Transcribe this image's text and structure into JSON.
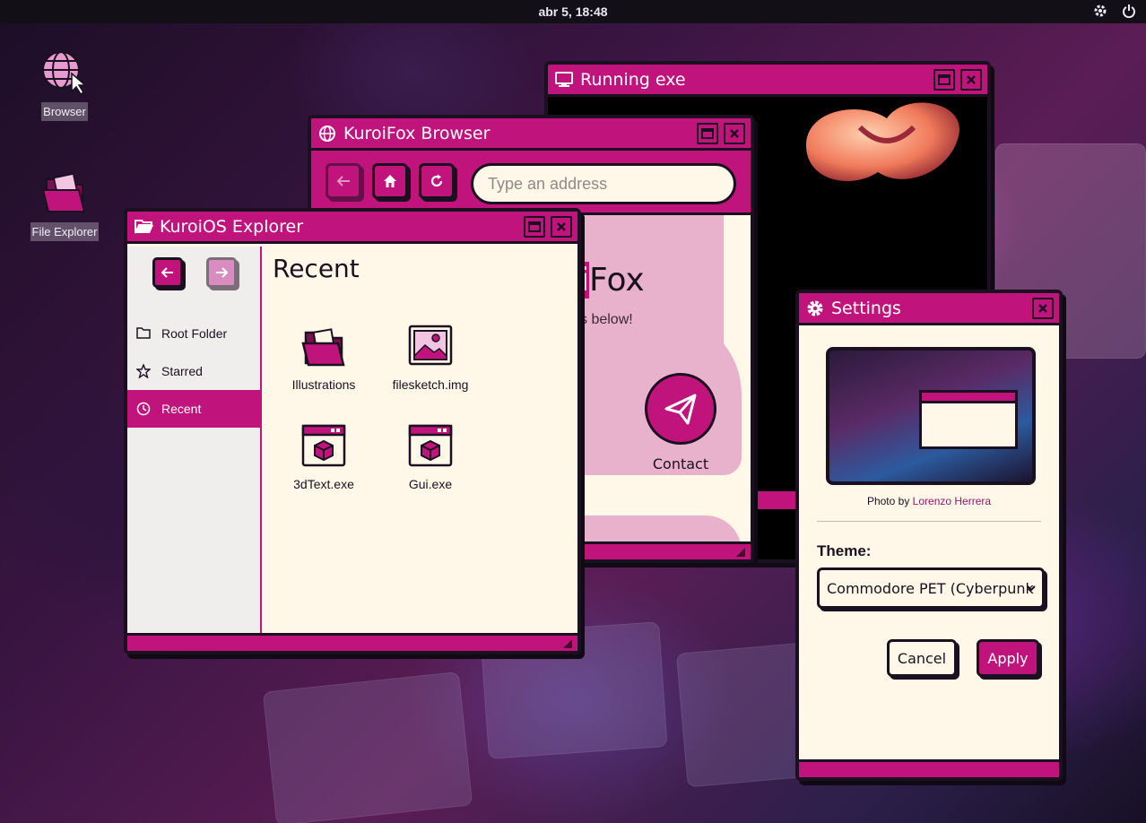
{
  "topbar": {
    "clock": "abr 5, 18:48",
    "icons": [
      "gear-icon",
      "power-icon"
    ]
  },
  "desktop": {
    "browser_label": "Browser",
    "explorer_label": "File Explorer"
  },
  "exe_window": {
    "title": "Running exe"
  },
  "browser_window": {
    "title": "KuroiFox Browser",
    "address_placeholder": "Type an address",
    "brand_highlight": "roi",
    "brand_rest": "Fox",
    "subtitle": "links below!",
    "contact_label": "Contact"
  },
  "explorer_window": {
    "title": "KuroiOS Explorer",
    "sidebar": [
      {
        "label": "Root Folder",
        "icon": "folder-icon"
      },
      {
        "label": "Starred",
        "icon": "star-icon"
      },
      {
        "label": "Recent",
        "icon": "clock-icon",
        "active": true
      }
    ],
    "heading": "Recent",
    "files": [
      {
        "name": "Illustrations",
        "icon": "folder-icon"
      },
      {
        "name": "filesketch.img",
        "icon": "image-icon"
      },
      {
        "name": "3dText.exe",
        "icon": "app-icon"
      },
      {
        "name": "Gui.exe",
        "icon": "app-icon"
      }
    ]
  },
  "settings_window": {
    "title": "Settings",
    "credit_prefix": "Photo by",
    "credit_author": "Lorenzo Herrera",
    "theme_label": "Theme:",
    "theme_value": "Commodore PET (Cyberpunk",
    "cancel_label": "Cancel",
    "apply_label": "Apply"
  },
  "colors": {
    "accent": "#c0147c",
    "window_bg": "#fff8e8",
    "border": "#1a1020",
    "topbar": "#121016"
  }
}
